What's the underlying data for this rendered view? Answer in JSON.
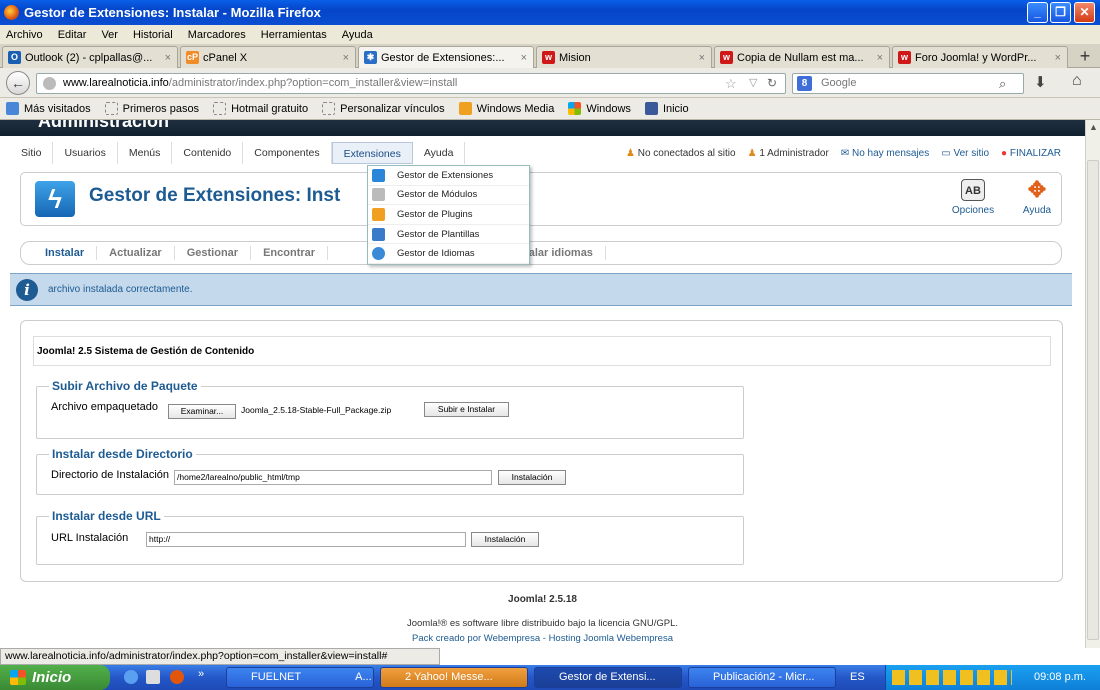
{
  "window": {
    "title": "Gestor de Extensiones: Instalar - Mozilla Firefox"
  },
  "menubar": [
    "Archivo",
    "Editar",
    "Ver",
    "Historial",
    "Marcadores",
    "Herramientas",
    "Ayuda"
  ],
  "tabs": [
    {
      "label": "Outlook (2) - cplpallas@..."
    },
    {
      "label": "cPanel X"
    },
    {
      "label": "Gestor de Extensiones:..."
    },
    {
      "label": "Mision"
    },
    {
      "label": "Copia de Nullam est ma..."
    },
    {
      "label": "Foro Joomla! y WordPr..."
    }
  ],
  "nav": {
    "url_domain": "www.larealnoticia.info",
    "url_path": "/administrator/index.php?option=com_installer&view=install",
    "search_placeholder": "Google"
  },
  "bookmarks": [
    "Más visitados",
    "Primeros pasos",
    "Hotmail gratuito",
    "Personalizar vínculos",
    "Windows Media",
    "Windows",
    "Inicio"
  ],
  "joomla": {
    "header_text": "Administración",
    "menu": [
      "Sitio",
      "Usuarios",
      "Menús",
      "Contenido",
      "Componentes",
      "Extensiones",
      "Ayuda"
    ],
    "status": [
      "No conectados al sitio",
      "1 Administrador",
      "No hay mensajes",
      "Ver sitio",
      "FINALIZAR"
    ],
    "page_title": "Gestor de Extensiones: Inst",
    "toolbar": {
      "options": "Opciones",
      "help": "Ayuda"
    },
    "subnav": [
      "Instalar",
      "Actualizar",
      "Gestionar",
      "Encontrar",
      "s",
      "Instalar idiomas"
    ],
    "message": "archivo instalada correctamente.",
    "version_title": "Joomla! 2.5 Sistema de Gestión de Contenido",
    "upload": {
      "legend": "Subir Archivo de Paquete",
      "label": "Archivo empaquetado",
      "browse": "Examinar...",
      "file": "Joomla_2.5.18-Stable-Full_Package.zip",
      "submit": "Subir e Instalar"
    },
    "directory": {
      "legend": "Instalar desde Directorio",
      "label": "Directorio de Instalación",
      "value": "/home2/larealno/public_html/tmp",
      "submit": "Instalación"
    },
    "url": {
      "legend": "Instalar desde URL",
      "label": "URL Instalación",
      "value": "http://",
      "submit": "Instalación"
    },
    "footer": {
      "version": "Joomla! 2.5.18",
      "license": "Joomla!® es software libre distribuido bajo la licencia GNU/GPL.",
      "credits": "Pack creado por Webempresa - Hosting Joomla Webempresa"
    },
    "dropdown": [
      "Gestor de Extensiones",
      "Gestor de Módulos",
      "Gestor de Plugins",
      "Gestor de Plantillas",
      "Gestor de Idiomas"
    ]
  },
  "statusbar": "www.larealnoticia.info/administrator/index.php?option=com_installer&view=install#",
  "taskbar": {
    "start": "Inicio",
    "tasks": [
      "FUELNET",
      "A...",
      "2 Yahoo! Messe...",
      "Gestor de Extensi...",
      "Publicación2 - Micr..."
    ],
    "lang": "ES",
    "clock": "09:08 p.m."
  },
  "colors": {
    "xp_blue": "#0a4ed2",
    "joomla_blue": "#1d5b92",
    "message_bg": "#c5d9ec"
  }
}
